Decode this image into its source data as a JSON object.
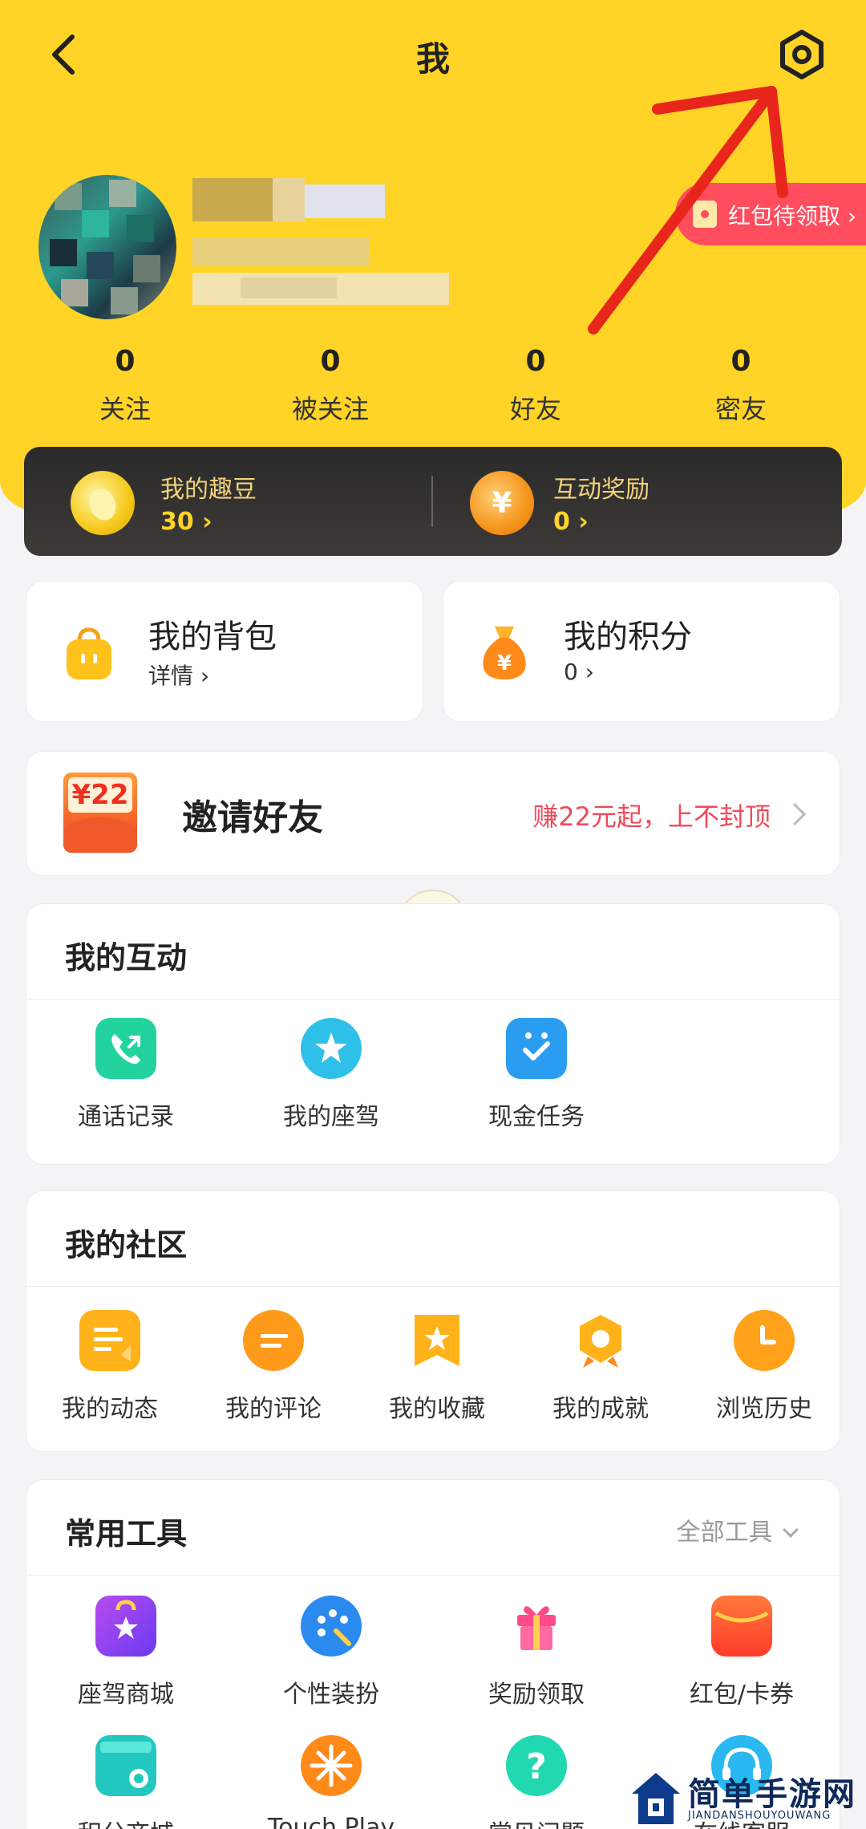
{
  "header": {
    "title": "我"
  },
  "red_packet": {
    "label": "红包待领取 ›"
  },
  "stats": [
    {
      "value": "0",
      "label": "关注"
    },
    {
      "value": "0",
      "label": "被关注"
    },
    {
      "value": "0",
      "label": "好友"
    },
    {
      "value": "0",
      "label": "密友"
    }
  ],
  "wallet": {
    "beans_label": "我的趣豆",
    "beans_value": "30 ›",
    "reward_label": "互动奖励",
    "reward_value": "0 ›"
  },
  "backpack": {
    "title": "我的背包",
    "sub": "详情 ›"
  },
  "points": {
    "title": "我的积分",
    "sub": "0 ›"
  },
  "invite": {
    "badge": "¥22",
    "title": "邀请好友",
    "sub": "赚22元起，上不封顶"
  },
  "interaction": {
    "title": "我的互动",
    "items": [
      "通话记录",
      "我的座驾",
      "现金任务"
    ]
  },
  "community": {
    "title": "我的社区",
    "items": [
      "我的动态",
      "我的评论",
      "我的收藏",
      "我的成就",
      "浏览历史"
    ]
  },
  "tools": {
    "title": "常用工具",
    "all_label": "全部工具",
    "items": [
      "座驾商城",
      "个性装扮",
      "奖励领取",
      "红包/卡券",
      "积分商城",
      "Touch Play",
      "常见问题",
      "在线客服"
    ]
  },
  "watermark": {
    "title": "简单手游网",
    "sub": "JIANDANSHOUYOUWANG"
  },
  "colors": {
    "brand_yellow": "#ffd426",
    "accent_red": "#f04a5a",
    "annotation_red": "#e8261c"
  }
}
